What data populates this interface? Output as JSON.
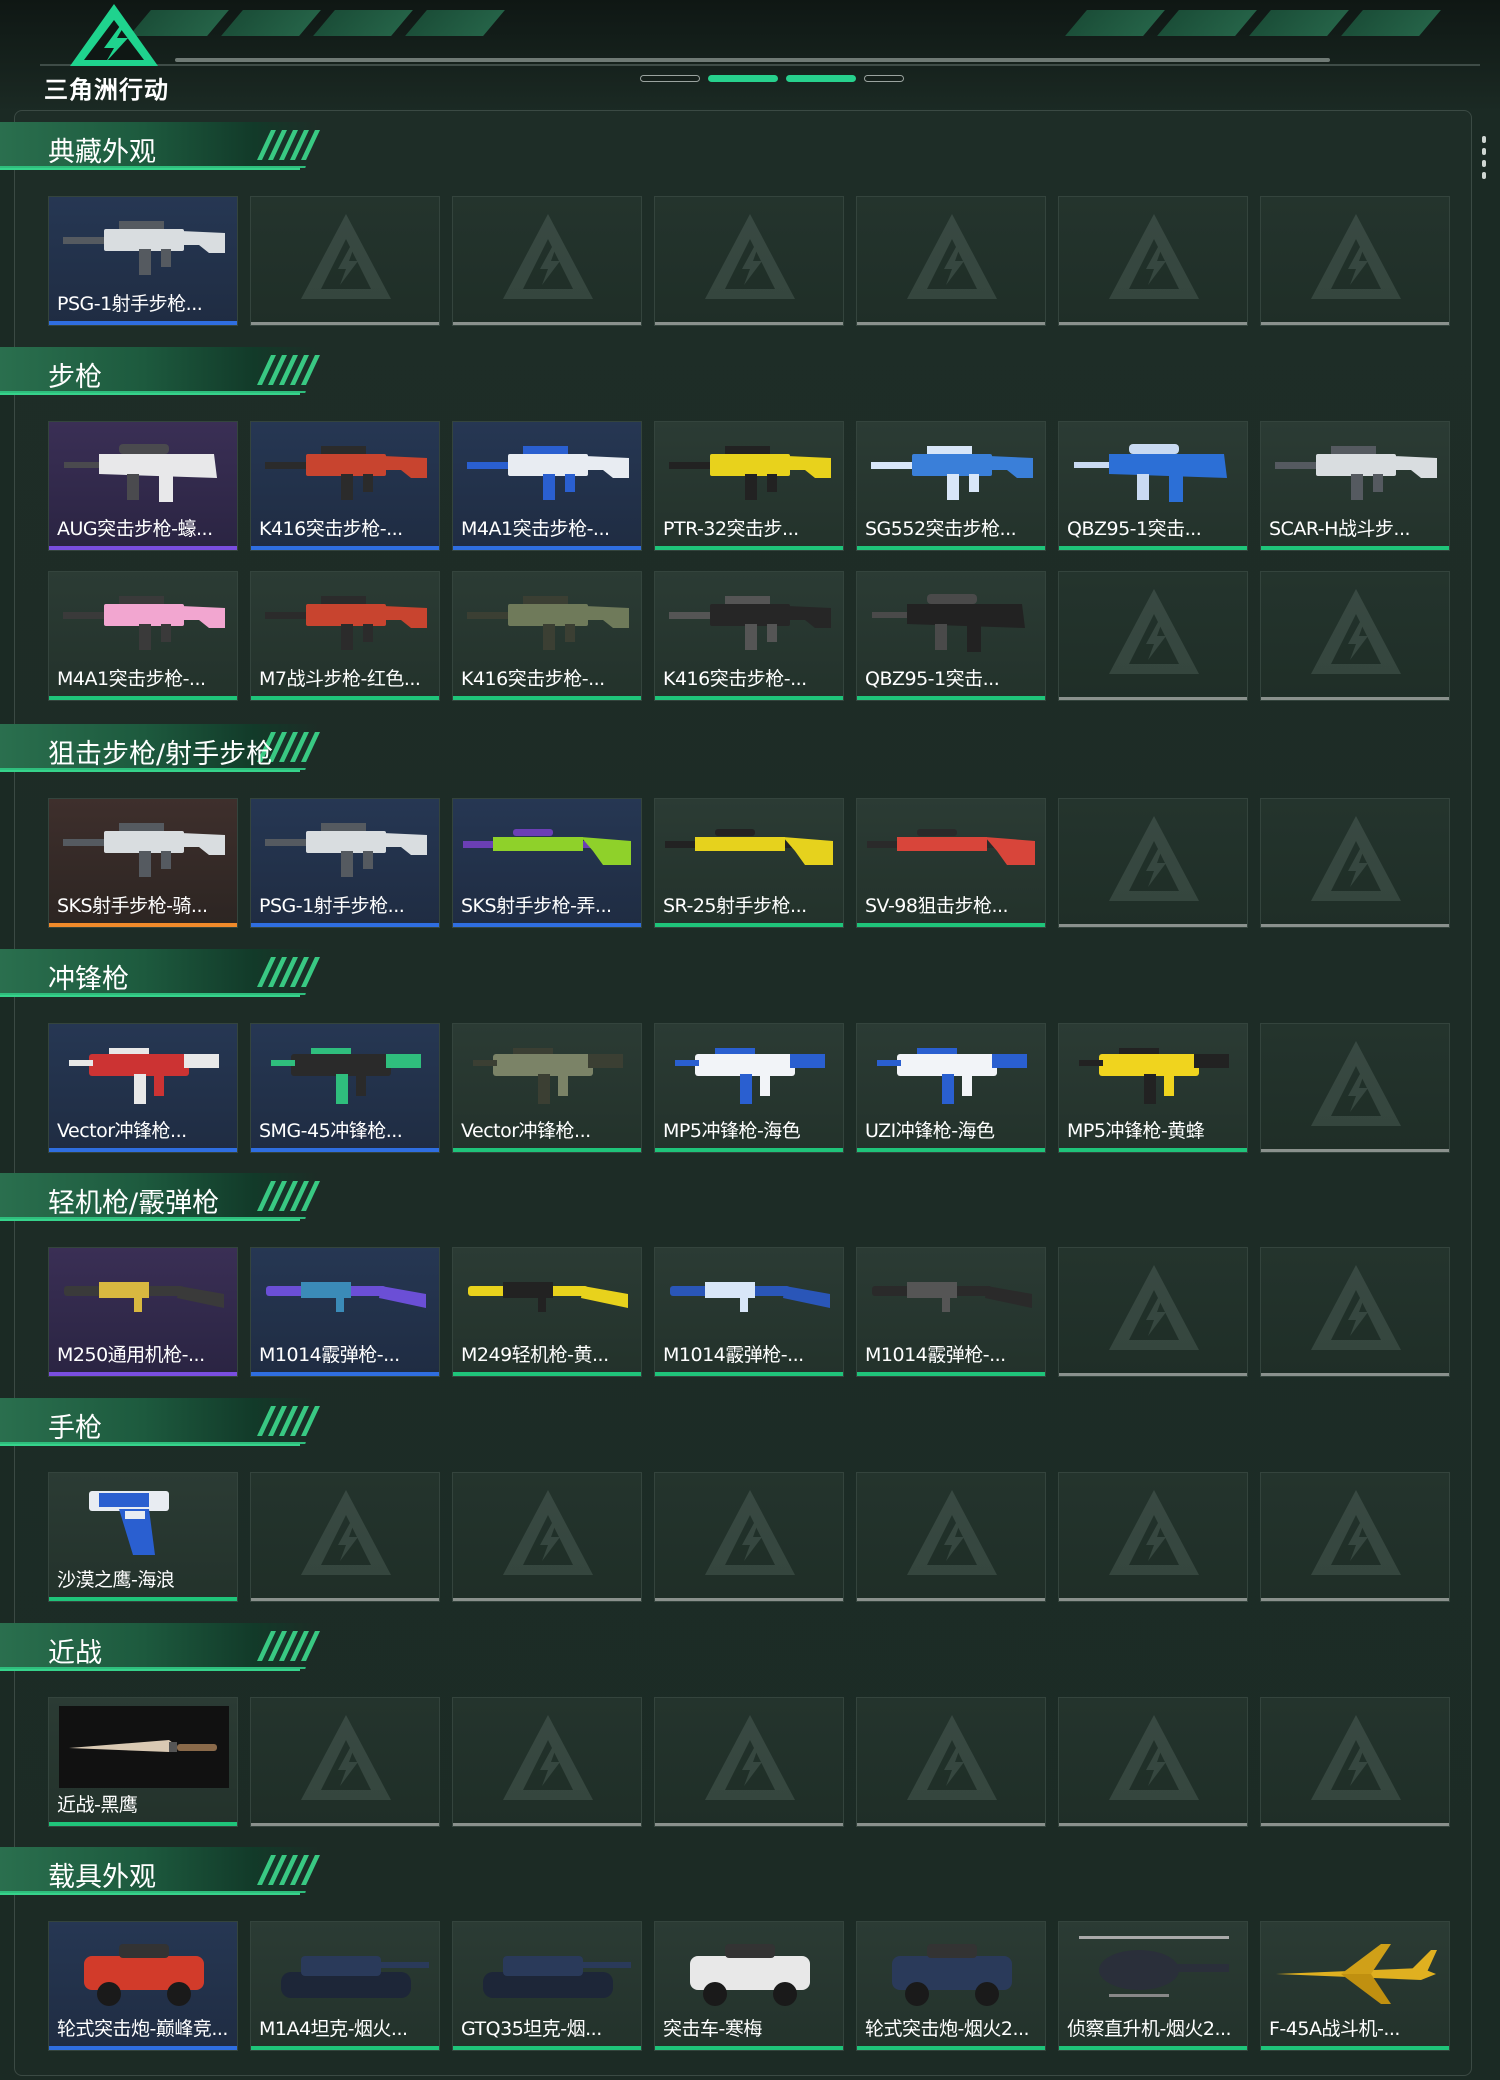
{
  "app": {
    "logo_text": "三角洲行动"
  },
  "colors": {
    "accent": "#2fbe7d",
    "rarity_purple": "#7a4ee0",
    "rarity_blue": "#2f6ee0",
    "rarity_orange": "#f08a2a",
    "rarity_green": "#1fc47a"
  },
  "sections": [
    {
      "title": "典藏外观",
      "rows": [
        [
          {
            "label": "PSG-1射手步枪...",
            "rarity": "blue",
            "art": "rifle-white"
          },
          null,
          null,
          null,
          null,
          null,
          null
        ]
      ]
    },
    {
      "title": "步枪",
      "rows": [
        [
          {
            "label": "AUG突击步枪-蠔...",
            "rarity": "purple",
            "art": "bullpup-white"
          },
          {
            "label": "K416突击步枪-...",
            "rarity": "blue",
            "art": "rifle-red"
          },
          {
            "label": "M4A1突击步枪-...",
            "rarity": "blue",
            "art": "rifle-bluewhite"
          },
          {
            "label": "PTR-32突击步...",
            "rarity": "green",
            "art": "rifle-yellow"
          },
          {
            "label": "SG552突击步枪...",
            "rarity": "green",
            "art": "rifle-blue"
          },
          {
            "label": "QBZ95-1突击...",
            "rarity": "green",
            "art": "bullpup-blue"
          },
          {
            "label": "SCAR-H战斗步...",
            "rarity": "green",
            "art": "rifle-white"
          }
        ],
        [
          {
            "label": "M4A1突击步枪-...",
            "rarity": "green",
            "art": "rifle-pink"
          },
          {
            "label": "M7战斗步枪-红色...",
            "rarity": "green",
            "art": "rifle-red"
          },
          {
            "label": "K416突击步枪-...",
            "rarity": "green",
            "art": "rifle-camo"
          },
          {
            "label": "K416突击步枪-...",
            "rarity": "green",
            "art": "rifle-black"
          },
          {
            "label": "QBZ95-1突击...",
            "rarity": "green",
            "art": "bullpup-black"
          },
          null,
          null
        ]
      ]
    },
    {
      "title": "狙击步枪/射手步枪",
      "rows": [
        [
          {
            "label": "SKS射手步枪-骑...",
            "rarity": "orange",
            "art": "rifle-white"
          },
          {
            "label": "PSG-1射手步枪...",
            "rarity": "blue",
            "art": "rifle-white"
          },
          {
            "label": "SKS射手步枪-弄...",
            "rarity": "blue",
            "art": "sniper-lime"
          },
          {
            "label": "SR-25射手步枪...",
            "rarity": "green",
            "art": "sniper-yellow"
          },
          {
            "label": "SV-98狙击步枪...",
            "rarity": "green",
            "art": "sniper-red"
          },
          null,
          null
        ]
      ]
    },
    {
      "title": "冲锋枪",
      "rows": [
        [
          {
            "label": "Vector冲锋枪...",
            "rarity": "blue",
            "art": "smg-red"
          },
          {
            "label": "SMG-45冲锋枪...",
            "rarity": "blue",
            "art": "smg-black"
          },
          {
            "label": "Vector冲锋枪...",
            "rarity": "green",
            "art": "smg-camo"
          },
          {
            "label": "MP5冲锋枪-海色",
            "rarity": "green",
            "art": "smg-bluewhite"
          },
          {
            "label": "UZI冲锋枪-海色",
            "rarity": "green",
            "art": "smg-bluewhite"
          },
          {
            "label": "MP5冲锋枪-黄蜂",
            "rarity": "green",
            "art": "smg-yellow"
          },
          null
        ]
      ]
    },
    {
      "title": "轻机枪/霰弹枪",
      "rows": [
        [
          {
            "label": "M250通用机枪-...",
            "rarity": "purple",
            "art": "lmg-dark"
          },
          {
            "label": "M1014霰弹枪-...",
            "rarity": "blue",
            "art": "shotgun-purple"
          },
          {
            "label": "M249轻机枪-黄...",
            "rarity": "green",
            "art": "lmg-yellow"
          },
          {
            "label": "M1014霰弹枪-...",
            "rarity": "green",
            "art": "shotgun-blue"
          },
          {
            "label": "M1014霰弹枪-...",
            "rarity": "green",
            "art": "shotgun-black"
          },
          null,
          null
        ]
      ]
    },
    {
      "title": "手枪",
      "rows": [
        [
          {
            "label": "沙漠之鹰-海浪",
            "rarity": "green",
            "art": "pistol-blue"
          },
          null,
          null,
          null,
          null,
          null,
          null
        ]
      ]
    },
    {
      "title": "近战",
      "rows": [
        [
          {
            "label": "近战-黑鹰",
            "rarity": "green",
            "art": "knife"
          },
          null,
          null,
          null,
          null,
          null,
          null
        ]
      ]
    },
    {
      "title": "载具外观",
      "rows": [
        [
          {
            "label": "轮式突击炮-巅峰竞...",
            "rarity": "blue",
            "art": "vehicle-red"
          },
          {
            "label": "M1A4坦克-烟火...",
            "rarity": "green",
            "art": "tank"
          },
          {
            "label": "GTQ35坦克-烟...",
            "rarity": "green",
            "art": "tank"
          },
          {
            "label": "突击车-寒梅",
            "rarity": "green",
            "art": "vehicle-white"
          },
          {
            "label": "轮式突击炮-烟火2...",
            "rarity": "green",
            "art": "vehicle-dark"
          },
          {
            "label": "侦察直升机-烟火2...",
            "rarity": "green",
            "art": "heli"
          },
          {
            "label": "F-45A战斗机-...",
            "rarity": "green",
            "art": "jet"
          }
        ]
      ]
    }
  ]
}
